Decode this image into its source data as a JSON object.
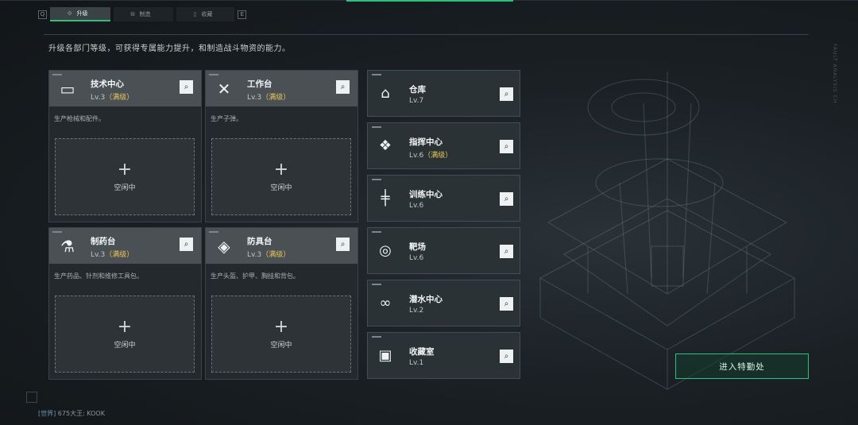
{
  "tabs": {
    "left_key": "Q",
    "right_key": "E",
    "items": [
      {
        "label": "升级",
        "icon": "upgrade-icon",
        "active": true
      },
      {
        "label": "制造",
        "icon": "craft-icon",
        "active": false
      },
      {
        "label": "收藏",
        "icon": "collection-icon",
        "active": false
      }
    ]
  },
  "description": "升级各部门等级，可获得专属能力提升，和制造战斗物资的能力。",
  "big_cards": [
    {
      "name": "技术中心",
      "level": "Lv.3",
      "max": "（满级）",
      "sub": "生产枪械和配件。",
      "slot": "空闲中",
      "icon": "tech-center-icon"
    },
    {
      "name": "工作台",
      "level": "Lv.3",
      "max": "（满级）",
      "sub": "生产子弹。",
      "slot": "空闲中",
      "icon": "workbench-icon"
    },
    {
      "name": "制药台",
      "level": "Lv.3",
      "max": "（满级）",
      "sub": "生产药品、针剂和维修工具包。",
      "slot": "空闲中",
      "icon": "pharmacy-icon"
    },
    {
      "name": "防具台",
      "level": "Lv.3",
      "max": "（满级）",
      "sub": "生产头盔、护甲、胸挂和背包。",
      "slot": "空闲中",
      "icon": "armor-bench-icon"
    }
  ],
  "small_cards": [
    {
      "name": "仓库",
      "level": "Lv.7",
      "max": "",
      "icon": "warehouse-icon"
    },
    {
      "name": "指挥中心",
      "level": "Lv.6",
      "max": "（满级）",
      "icon": "command-center-icon"
    },
    {
      "name": "训练中心",
      "level": "Lv.6",
      "max": "",
      "icon": "training-center-icon"
    },
    {
      "name": "靶场",
      "level": "Lv.6",
      "max": "",
      "icon": "shooting-range-icon"
    },
    {
      "name": "潜水中心",
      "level": "Lv.2",
      "max": "",
      "icon": "dive-center-icon"
    },
    {
      "name": "收藏室",
      "level": "Lv.1",
      "max": "",
      "icon": "collection-room-icon"
    }
  ],
  "enter_button": "进入特勤处",
  "chat": {
    "channel": "[世界]",
    "message": "675大王: KOOK"
  },
  "colors": {
    "accent": "#2fbf7d",
    "max_level": "#e8c65a"
  }
}
